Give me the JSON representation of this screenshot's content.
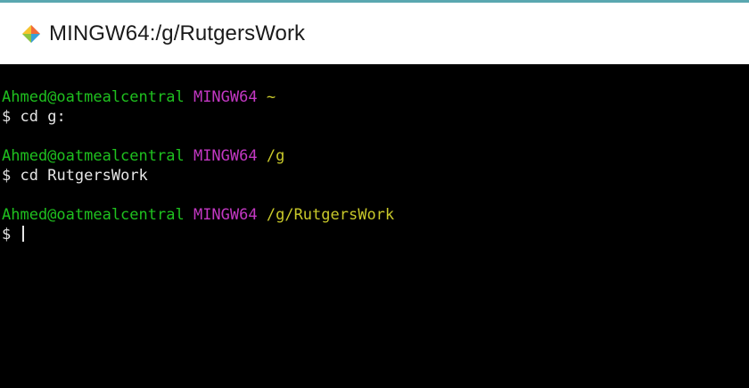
{
  "window": {
    "title": "MINGW64:/g/RutgersWork",
    "icon": "git-diamond-icon",
    "accent_color": "#5aa7b0"
  },
  "terminal": {
    "colors": {
      "background": "#000000",
      "user": "#1fc11f",
      "shell": "#c338c3",
      "path": "#c9c92a",
      "text": "#e6e6e6"
    },
    "blocks": [
      {
        "user_host": "Ahmed@oatmealcentral",
        "shell": "MINGW64",
        "path": "~",
        "prompt": "$",
        "command": "cd g:"
      },
      {
        "user_host": "Ahmed@oatmealcentral",
        "shell": "MINGW64",
        "path": "/g",
        "prompt": "$",
        "command": "cd RutgersWork"
      },
      {
        "user_host": "Ahmed@oatmealcentral",
        "shell": "MINGW64",
        "path": "/g/RutgersWork",
        "prompt": "$",
        "command": ""
      }
    ]
  }
}
